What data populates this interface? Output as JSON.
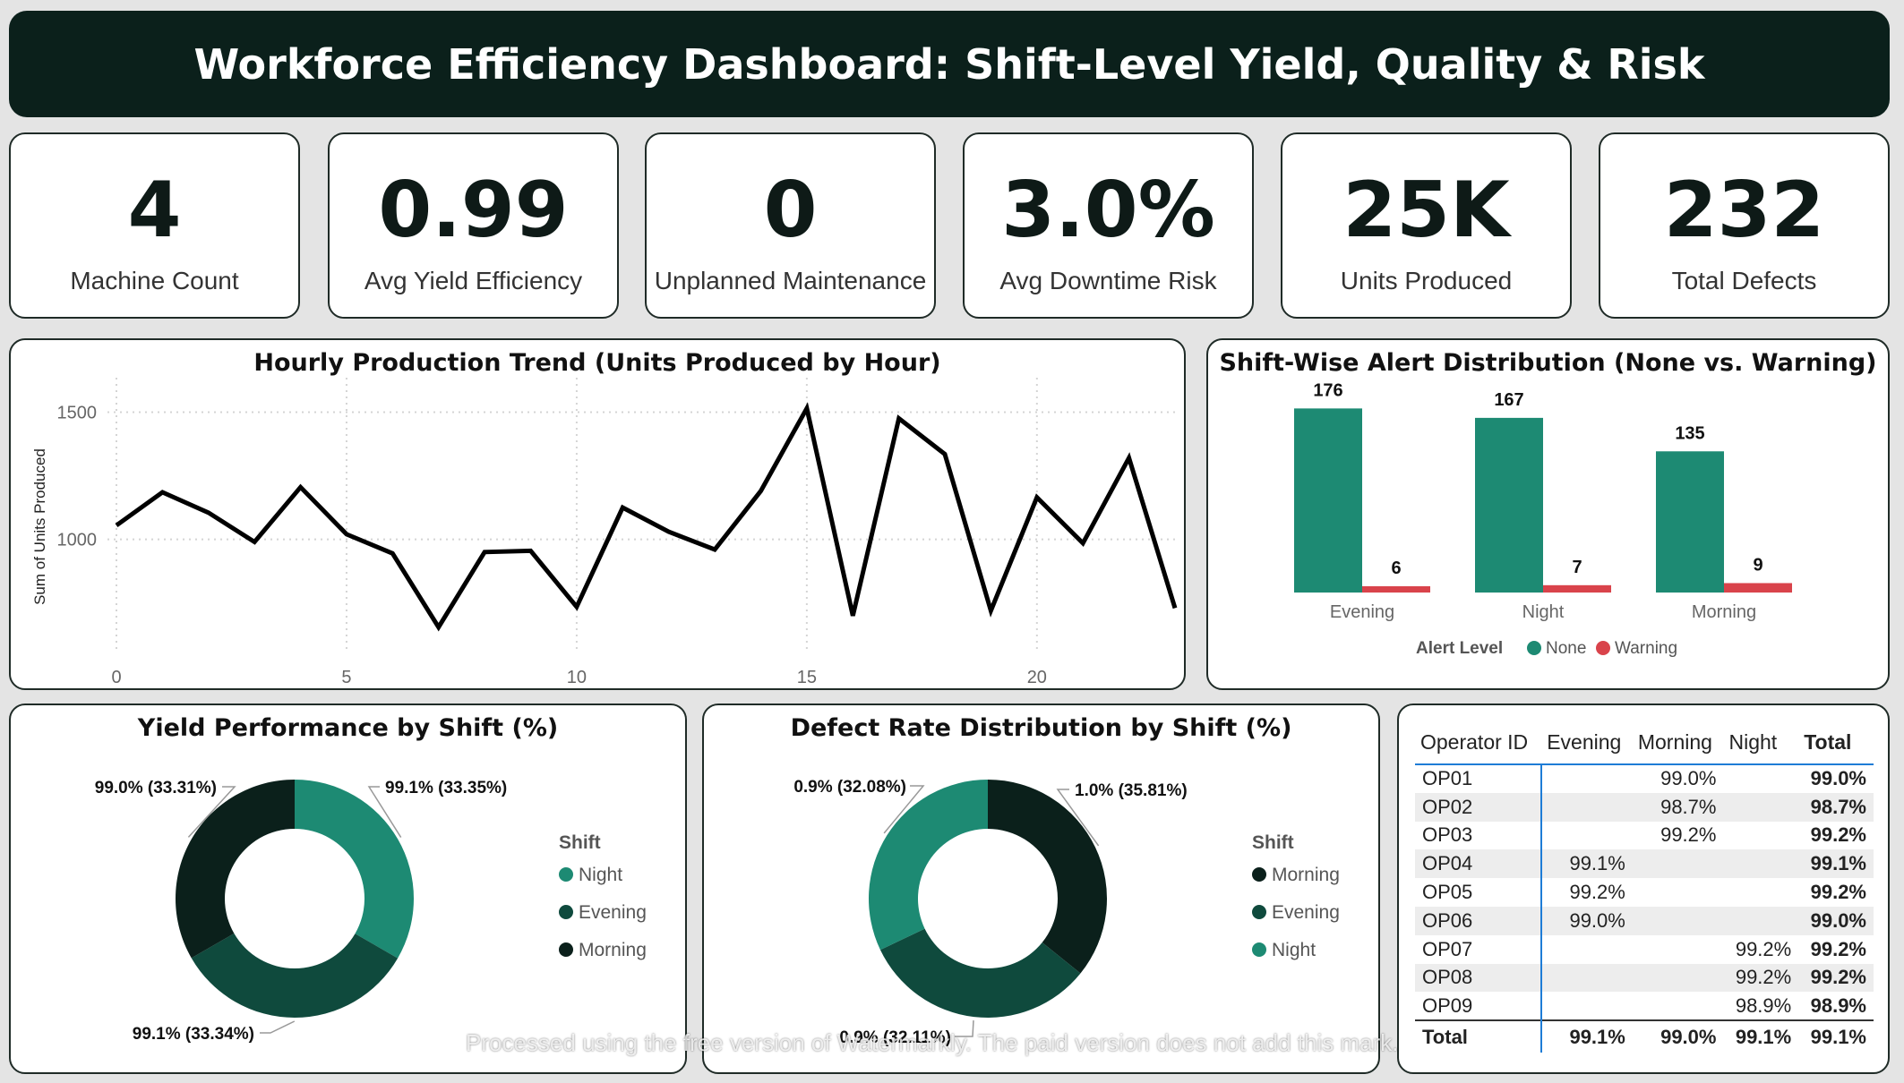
{
  "title": "Workforce Efficiency Dashboard: Shift-Level Yield, Quality & Risk",
  "kpis": [
    {
      "value": "4",
      "label": "Machine Count"
    },
    {
      "value": "0.99",
      "label": "Avg Yield Efficiency"
    },
    {
      "value": "0",
      "label": "Unplanned Maintenance"
    },
    {
      "value": "3.0%",
      "label": "Avg Downtime Risk"
    },
    {
      "value": "25K",
      "label": "Units Produced"
    },
    {
      "value": "232",
      "label": "Total Defects"
    }
  ],
  "colors": {
    "dark": "#0b201b",
    "teal": "#1d8a73",
    "mid_green": "#0f4a3d",
    "red": "#d9434b",
    "line": "#000000"
  },
  "chart_data": [
    {
      "id": "hourly",
      "type": "line",
      "title": "Hourly Production Trend (Units Produced by Hour)",
      "xlabel": "",
      "ylabel": "Sum of Units Produced",
      "xlim": [
        0,
        23
      ],
      "ylim": [
        640,
        1600
      ],
      "xticks": [
        0,
        5,
        10,
        15,
        20
      ],
      "yticks": [
        1000,
        1500
      ],
      "grid": true,
      "x": [
        0,
        1,
        2,
        3,
        4,
        5,
        6,
        7,
        8,
        9,
        10,
        11,
        12,
        13,
        14,
        15,
        16,
        17,
        18,
        19,
        20,
        21,
        22,
        23
      ],
      "values": [
        1055,
        1185,
        1105,
        990,
        1205,
        1020,
        945,
        655,
        950,
        955,
        735,
        1125,
        1030,
        960,
        1190,
        1515,
        700,
        1475,
        1335,
        720,
        1165,
        985,
        1320,
        730
      ]
    },
    {
      "id": "alerts",
      "type": "bar",
      "title": "Shift-Wise Alert Distribution (None vs. Warning)",
      "categories": [
        "Evening",
        "Night",
        "Morning"
      ],
      "legend_title": "Alert Level",
      "legend_position": "bottom",
      "series": [
        {
          "name": "None",
          "values": [
            176,
            167,
            135
          ],
          "color": "#1d8a73"
        },
        {
          "name": "Warning",
          "values": [
            6,
            7,
            9
          ],
          "color": "#d9434b"
        }
      ],
      "ylim": [
        0,
        190
      ]
    },
    {
      "id": "yield",
      "type": "pie",
      "title": "Yield Performance by Shift (%)",
      "legend_title": "Shift",
      "legend_position": "right",
      "slices": [
        {
          "name": "Night",
          "value": 33.35,
          "label": "99.1% (33.35%)",
          "color": "#1d8a73"
        },
        {
          "name": "Evening",
          "value": 33.34,
          "label": "99.1% (33.34%)",
          "color": "#0f4a3d"
        },
        {
          "name": "Morning",
          "value": 33.31,
          "label": "99.0% (33.31%)",
          "color": "#0b201b"
        }
      ]
    },
    {
      "id": "defect",
      "type": "pie",
      "title": "Defect Rate Distribution by Shift (%)",
      "legend_title": "Shift",
      "legend_position": "right",
      "slices": [
        {
          "name": "Morning",
          "value": 35.81,
          "label": "1.0% (35.81%)",
          "color": "#0b201b"
        },
        {
          "name": "Evening",
          "value": 32.11,
          "label": "0.9% (32.11%)",
          "color": "#0f4a3d"
        },
        {
          "name": "Night",
          "value": 32.08,
          "label": "0.9% (32.08%)",
          "color": "#1d8a73"
        }
      ]
    }
  ],
  "table": {
    "headers": [
      "Operator ID",
      "Evening",
      "Morning",
      "Night",
      "Total"
    ],
    "rows": [
      [
        "OP01",
        "",
        "99.0%",
        "",
        "99.0%"
      ],
      [
        "OP02",
        "",
        "98.7%",
        "",
        "98.7%"
      ],
      [
        "OP03",
        "",
        "99.2%",
        "",
        "99.2%"
      ],
      [
        "OP04",
        "99.1%",
        "",
        "",
        "99.1%"
      ],
      [
        "OP05",
        "99.2%",
        "",
        "",
        "99.2%"
      ],
      [
        "OP06",
        "99.0%",
        "",
        "",
        "99.0%"
      ],
      [
        "OP07",
        "",
        "",
        "99.2%",
        "99.2%"
      ],
      [
        "OP08",
        "",
        "",
        "99.2%",
        "99.2%"
      ],
      [
        "OP09",
        "",
        "",
        "98.9%",
        "98.9%"
      ]
    ],
    "total_row": [
      "Total",
      "99.1%",
      "99.0%",
      "99.1%",
      "99.1%"
    ]
  },
  "watermark_notice": "Processed using the free version of Watermarkly. The paid version does not add this mark."
}
